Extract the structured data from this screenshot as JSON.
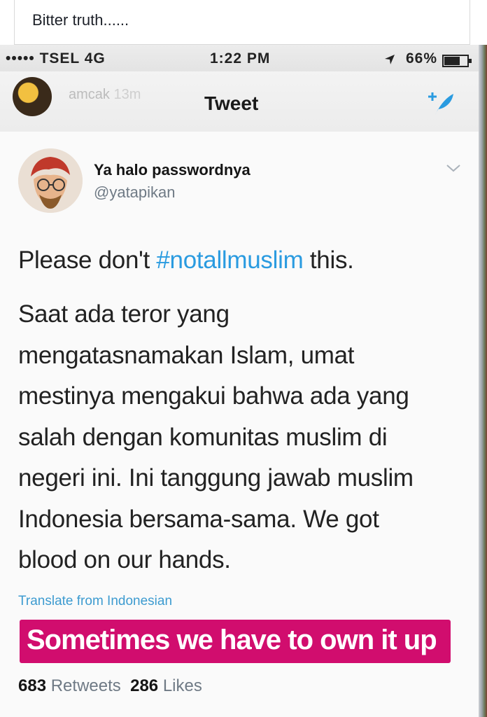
{
  "caption": {
    "text": "Bitter truth......"
  },
  "status_bar": {
    "carrier": "••••• TSEL  4G",
    "time": "1:22 PM",
    "battery": "66%"
  },
  "nav": {
    "story_user": "amcak",
    "story_time": "13m",
    "title": "Tweet"
  },
  "tweet": {
    "display_name": "Ya halo passwordnya",
    "handle": "@yatapikan",
    "first_line": {
      "before": "Please don't ",
      "hashtag": "#notallmuslim",
      "after": " this."
    },
    "body_lines": [
      "Saat ada teror yang",
      "mengatasnamakan Islam, umat",
      "mestinya mengakui bahwa ada yang",
      "salah dengan komunitas muslim di",
      "negeri ini. Ini tanggung jawab muslim",
      "Indonesia bersama-sama. We got",
      "blood on our hands."
    ],
    "translate_label": "Translate from Indonesian",
    "retweets_count": "683",
    "retweets_label": "Retweets",
    "likes_count": "286",
    "likes_label": "Likes"
  },
  "overlay": {
    "text": "Sometimes we have to own it up",
    "color": "#d10d6e"
  },
  "icons": {
    "compose": "compose-tweet-icon",
    "chevron": "chevron-down-icon",
    "battery": "battery-icon",
    "location": "location-arrow-icon"
  },
  "colors": {
    "hashtag": "#2a9be0",
    "translate": "#3d9bd0",
    "handle": "#6f7a85"
  }
}
